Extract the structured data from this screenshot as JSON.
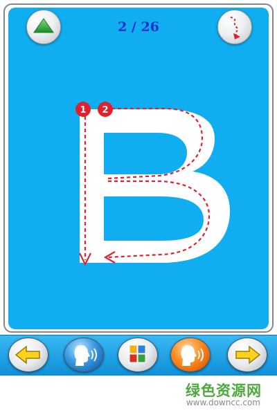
{
  "header": {
    "counter": "2 / 26",
    "up_button_icon": "green-triangle-up-icon",
    "trace_button_icon": "dotted-path-arrow-icon"
  },
  "letter": {
    "glyph": "B",
    "stroke_1_label": "1",
    "stroke_2_label": "2"
  },
  "toolbar": {
    "buttons": [
      {
        "icon": "left-arrow-icon"
      },
      {
        "icon": "speaking-head-icon"
      },
      {
        "icon": "color-squares-icon"
      },
      {
        "icon": "speaking-head-icon"
      },
      {
        "icon": "right-arrow-icon"
      }
    ]
  },
  "watermark": {
    "title": "绿色资源网",
    "url": "www.downcc.com"
  },
  "colors": {
    "panel": "#10aef0",
    "counter_text": "#1a2fd6",
    "guide_line": "#e0202a",
    "arrow_yellow": "#ffd21f",
    "watermark_green": "#4caa3c"
  }
}
